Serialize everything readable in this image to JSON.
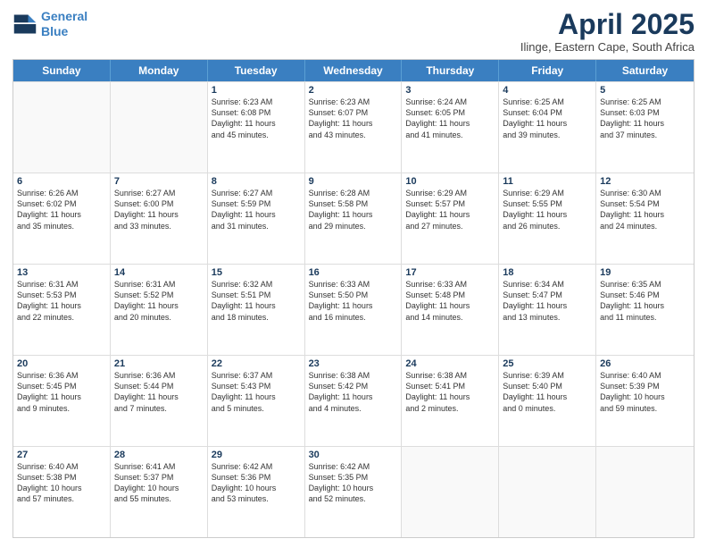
{
  "header": {
    "logo_line1": "General",
    "logo_line2": "Blue",
    "month": "April 2025",
    "location": "Ilinge, Eastern Cape, South Africa"
  },
  "weekdays": [
    "Sunday",
    "Monday",
    "Tuesday",
    "Wednesday",
    "Thursday",
    "Friday",
    "Saturday"
  ],
  "rows": [
    [
      {
        "day": "",
        "lines": []
      },
      {
        "day": "",
        "lines": []
      },
      {
        "day": "1",
        "lines": [
          "Sunrise: 6:23 AM",
          "Sunset: 6:08 PM",
          "Daylight: 11 hours",
          "and 45 minutes."
        ]
      },
      {
        "day": "2",
        "lines": [
          "Sunrise: 6:23 AM",
          "Sunset: 6:07 PM",
          "Daylight: 11 hours",
          "and 43 minutes."
        ]
      },
      {
        "day": "3",
        "lines": [
          "Sunrise: 6:24 AM",
          "Sunset: 6:05 PM",
          "Daylight: 11 hours",
          "and 41 minutes."
        ]
      },
      {
        "day": "4",
        "lines": [
          "Sunrise: 6:25 AM",
          "Sunset: 6:04 PM",
          "Daylight: 11 hours",
          "and 39 minutes."
        ]
      },
      {
        "day": "5",
        "lines": [
          "Sunrise: 6:25 AM",
          "Sunset: 6:03 PM",
          "Daylight: 11 hours",
          "and 37 minutes."
        ]
      }
    ],
    [
      {
        "day": "6",
        "lines": [
          "Sunrise: 6:26 AM",
          "Sunset: 6:02 PM",
          "Daylight: 11 hours",
          "and 35 minutes."
        ]
      },
      {
        "day": "7",
        "lines": [
          "Sunrise: 6:27 AM",
          "Sunset: 6:00 PM",
          "Daylight: 11 hours",
          "and 33 minutes."
        ]
      },
      {
        "day": "8",
        "lines": [
          "Sunrise: 6:27 AM",
          "Sunset: 5:59 PM",
          "Daylight: 11 hours",
          "and 31 minutes."
        ]
      },
      {
        "day": "9",
        "lines": [
          "Sunrise: 6:28 AM",
          "Sunset: 5:58 PM",
          "Daylight: 11 hours",
          "and 29 minutes."
        ]
      },
      {
        "day": "10",
        "lines": [
          "Sunrise: 6:29 AM",
          "Sunset: 5:57 PM",
          "Daylight: 11 hours",
          "and 27 minutes."
        ]
      },
      {
        "day": "11",
        "lines": [
          "Sunrise: 6:29 AM",
          "Sunset: 5:55 PM",
          "Daylight: 11 hours",
          "and 26 minutes."
        ]
      },
      {
        "day": "12",
        "lines": [
          "Sunrise: 6:30 AM",
          "Sunset: 5:54 PM",
          "Daylight: 11 hours",
          "and 24 minutes."
        ]
      }
    ],
    [
      {
        "day": "13",
        "lines": [
          "Sunrise: 6:31 AM",
          "Sunset: 5:53 PM",
          "Daylight: 11 hours",
          "and 22 minutes."
        ]
      },
      {
        "day": "14",
        "lines": [
          "Sunrise: 6:31 AM",
          "Sunset: 5:52 PM",
          "Daylight: 11 hours",
          "and 20 minutes."
        ]
      },
      {
        "day": "15",
        "lines": [
          "Sunrise: 6:32 AM",
          "Sunset: 5:51 PM",
          "Daylight: 11 hours",
          "and 18 minutes."
        ]
      },
      {
        "day": "16",
        "lines": [
          "Sunrise: 6:33 AM",
          "Sunset: 5:50 PM",
          "Daylight: 11 hours",
          "and 16 minutes."
        ]
      },
      {
        "day": "17",
        "lines": [
          "Sunrise: 6:33 AM",
          "Sunset: 5:48 PM",
          "Daylight: 11 hours",
          "and 14 minutes."
        ]
      },
      {
        "day": "18",
        "lines": [
          "Sunrise: 6:34 AM",
          "Sunset: 5:47 PM",
          "Daylight: 11 hours",
          "and 13 minutes."
        ]
      },
      {
        "day": "19",
        "lines": [
          "Sunrise: 6:35 AM",
          "Sunset: 5:46 PM",
          "Daylight: 11 hours",
          "and 11 minutes."
        ]
      }
    ],
    [
      {
        "day": "20",
        "lines": [
          "Sunrise: 6:36 AM",
          "Sunset: 5:45 PM",
          "Daylight: 11 hours",
          "and 9 minutes."
        ]
      },
      {
        "day": "21",
        "lines": [
          "Sunrise: 6:36 AM",
          "Sunset: 5:44 PM",
          "Daylight: 11 hours",
          "and 7 minutes."
        ]
      },
      {
        "day": "22",
        "lines": [
          "Sunrise: 6:37 AM",
          "Sunset: 5:43 PM",
          "Daylight: 11 hours",
          "and 5 minutes."
        ]
      },
      {
        "day": "23",
        "lines": [
          "Sunrise: 6:38 AM",
          "Sunset: 5:42 PM",
          "Daylight: 11 hours",
          "and 4 minutes."
        ]
      },
      {
        "day": "24",
        "lines": [
          "Sunrise: 6:38 AM",
          "Sunset: 5:41 PM",
          "Daylight: 11 hours",
          "and 2 minutes."
        ]
      },
      {
        "day": "25",
        "lines": [
          "Sunrise: 6:39 AM",
          "Sunset: 5:40 PM",
          "Daylight: 11 hours",
          "and 0 minutes."
        ]
      },
      {
        "day": "26",
        "lines": [
          "Sunrise: 6:40 AM",
          "Sunset: 5:39 PM",
          "Daylight: 10 hours",
          "and 59 minutes."
        ]
      }
    ],
    [
      {
        "day": "27",
        "lines": [
          "Sunrise: 6:40 AM",
          "Sunset: 5:38 PM",
          "Daylight: 10 hours",
          "and 57 minutes."
        ]
      },
      {
        "day": "28",
        "lines": [
          "Sunrise: 6:41 AM",
          "Sunset: 5:37 PM",
          "Daylight: 10 hours",
          "and 55 minutes."
        ]
      },
      {
        "day": "29",
        "lines": [
          "Sunrise: 6:42 AM",
          "Sunset: 5:36 PM",
          "Daylight: 10 hours",
          "and 53 minutes."
        ]
      },
      {
        "day": "30",
        "lines": [
          "Sunrise: 6:42 AM",
          "Sunset: 5:35 PM",
          "Daylight: 10 hours",
          "and 52 minutes."
        ]
      },
      {
        "day": "",
        "lines": []
      },
      {
        "day": "",
        "lines": []
      },
      {
        "day": "",
        "lines": []
      }
    ]
  ]
}
